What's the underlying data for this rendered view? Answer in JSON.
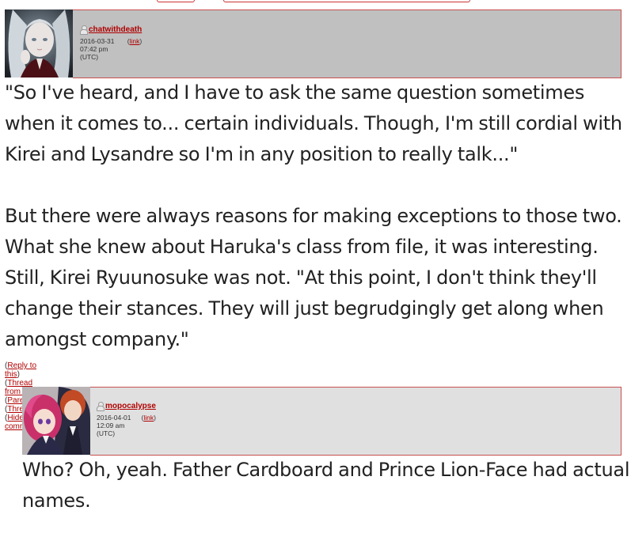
{
  "comments": [
    {
      "username": "chatwithdeath",
      "datetime": "2016-03-31 07:42 pm (UTC)",
      "link_label": "link",
      "header_color": "#c0c0c0",
      "body": [
        "\"So I've heard, and I have to ask the same question sometimes",
        "when it comes to... certain individuals. Though, I'm still cordial with",
        "Kirei and Lysandre so I'm in any position to really talk...\"",
        "",
        "But there were always reasons for making exceptions to those two.",
        "What she knew about Haruka's class from file, it was interesting.",
        "Still, Kirei Ryuunosuke was not. \"At this point, I don't think they'll",
        "change their stances. They will just begrudgingly get along when",
        "amongst company.\""
      ],
      "actions": [
        "Reply to this",
        "Thread from start",
        "Parent",
        "Thread",
        "Hide 40 comments"
      ]
    },
    {
      "username": "mopocalypse",
      "datetime": "2016-04-01 12:09 am (UTC)",
      "link_label": "link",
      "header_color": "#e0e0e0",
      "body": [
        "Who? Oh, yeah. Father Cardboard and Prince Lion-Face had actual",
        "names."
      ]
    }
  ]
}
